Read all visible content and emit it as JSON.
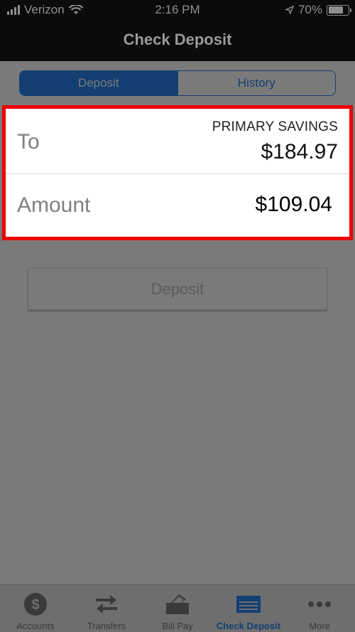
{
  "status_bar": {
    "carrier": "Verizon",
    "time": "2:16 PM",
    "battery": "70%",
    "battery_level": 0.7
  },
  "nav": {
    "title": "Check Deposit"
  },
  "segments": {
    "deposit": "Deposit",
    "history": "History",
    "selected": "Deposit"
  },
  "form": {
    "to_label": "To",
    "account_name": "PRIMARY SAVINGS",
    "account_balance": "$184.97",
    "amount_label": "Amount",
    "amount_value": "$109.04"
  },
  "deposit_button": "Deposit",
  "tabs": [
    {
      "label": "Accounts",
      "icon": "dollar-circle-icon"
    },
    {
      "label": "Transfers",
      "icon": "transfer-arrows-icon"
    },
    {
      "label": "Bill Pay",
      "icon": "bill-pay-icon"
    },
    {
      "label": "Check Deposit",
      "icon": "check-deposit-icon",
      "active": true
    },
    {
      "label": "More",
      "icon": "more-dots-icon"
    }
  ],
  "colors": {
    "accent": "#133f73",
    "highlight_border": "#ee0000",
    "overlay_gray": "#7a7a7a"
  }
}
